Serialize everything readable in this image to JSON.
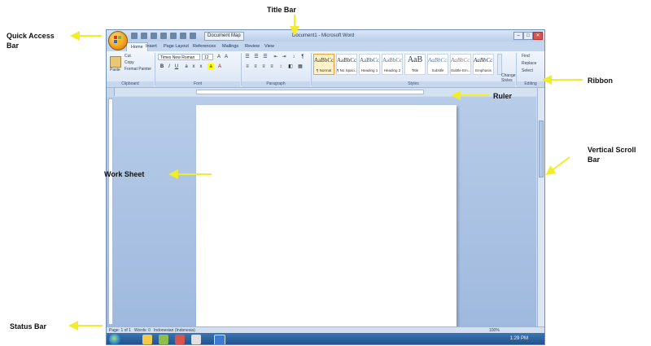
{
  "annotations": {
    "title_bar": "Title Bar",
    "quick_access_bar": "Quick Access\nBar",
    "ribbon": "Ribbon",
    "ruler": "Ruler",
    "vertical_scroll_bar": "Vertical Scroll\nBar",
    "work_sheet": "Work Sheet",
    "status_bar": "Status Bar"
  },
  "colors": {
    "arrow": "#f2ec2a",
    "window": "#c9d9ee",
    "page": "#ffffff",
    "taskbar": "#1f4e88"
  },
  "window": {
    "title": "Document1 - Microsoft Word",
    "document_map": "Document Map"
  },
  "tabs": [
    "Home",
    "Insert",
    "Page Layout",
    "References",
    "Mailings",
    "Review",
    "View"
  ],
  "clipboard": {
    "paste": "Paste",
    "cut": "Cut",
    "copy": "Copy",
    "format_painter": "Format Painter",
    "group_label": "Clipboard"
  },
  "font": {
    "name": "Times New Roman",
    "size": "12",
    "group_label": "Font"
  },
  "paragraph": {
    "group_label": "Paragraph"
  },
  "styles": {
    "items": [
      {
        "sample": "AaBbCcI",
        "name": "¶ Normal"
      },
      {
        "sample": "AaBbCcI",
        "name": "¶ No Spaci..."
      },
      {
        "sample": "AaBbCc",
        "name": "Heading 1"
      },
      {
        "sample": "AaBbCc",
        "name": "Heading 2"
      },
      {
        "sample": "AaB",
        "name": "Title"
      },
      {
        "sample": "AaBbCc.",
        "name": "Subtitle"
      },
      {
        "sample": "AaBbCcDt",
        "name": "Subtle Em..."
      },
      {
        "sample": "AaBbCcDt",
        "name": "Emphasis"
      }
    ],
    "change_styles": "Change\nStyles",
    "group_label": "Styles"
  },
  "editing": {
    "find": "Find",
    "replace": "Replace",
    "select": "Select",
    "group_label": "Editing"
  },
  "status": {
    "page": "Page: 1 of 1",
    "words": "Words: 0",
    "language": "Indonesian (Indonesia)",
    "zoom": "100%"
  },
  "taskbar": {
    "time": "1:29 PM"
  }
}
